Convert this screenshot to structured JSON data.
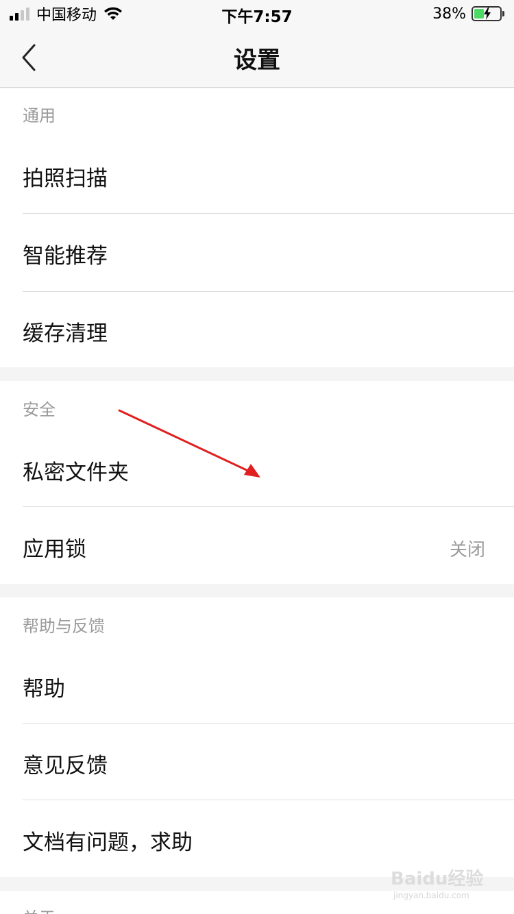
{
  "status_bar": {
    "carrier": "中国移动",
    "time": "下午7:57",
    "battery": "38%",
    "battery_level": 0.38
  },
  "nav": {
    "title": "设置",
    "back_icon": "chevron-left-icon"
  },
  "sections": {
    "general": {
      "header": "通用",
      "items": [
        {
          "label": "拍照扫描"
        },
        {
          "label": "智能推荐"
        },
        {
          "label": "缓存清理"
        }
      ]
    },
    "security": {
      "header": "安全",
      "items": [
        {
          "label": "私密文件夹"
        },
        {
          "label": "应用锁",
          "value": "关闭"
        }
      ]
    },
    "help": {
      "header": "帮助与反馈",
      "items": [
        {
          "label": "帮助"
        },
        {
          "label": "意见反馈"
        },
        {
          "label": "文档有问题，求助"
        }
      ]
    },
    "about": {
      "header": "关于"
    }
  },
  "annotation": {
    "arrow_color": "#e02020"
  },
  "watermark": {
    "text": "Baidu经验",
    "sub": "jingyan.baidu.com"
  }
}
